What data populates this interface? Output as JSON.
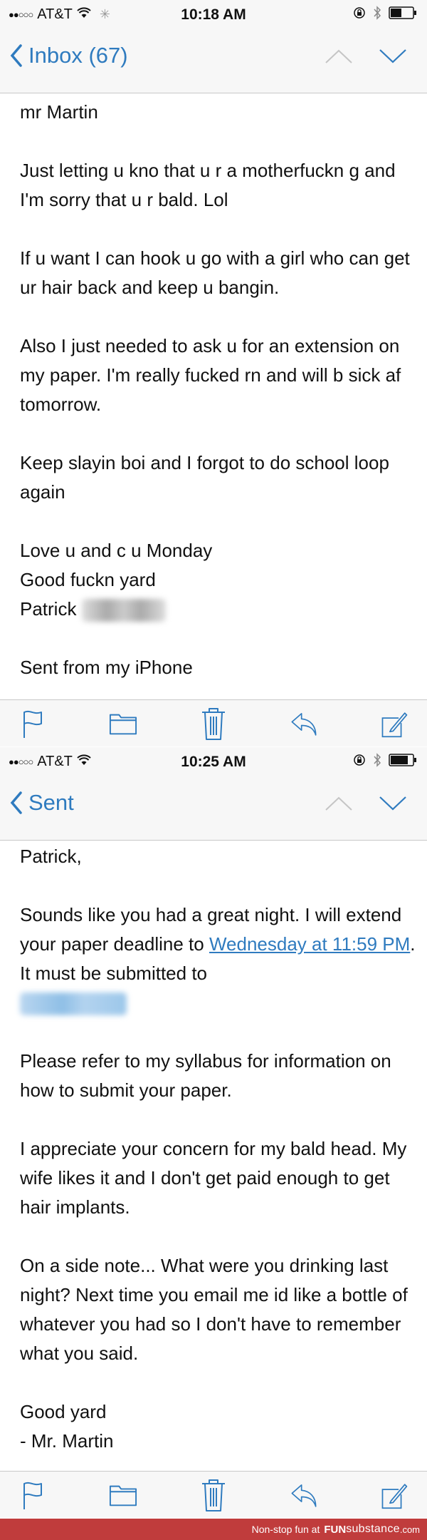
{
  "colors": {
    "accent": "#2f7bbf",
    "chrome_bg": "#f7f7f7",
    "banner_bg": "#c03c3c",
    "text": "#111111"
  },
  "screens": [
    {
      "status": {
        "signal_dots": "●●○○○",
        "carrier": "AT&T",
        "time": "10:18 AM",
        "battery_level": 0.5
      },
      "nav": {
        "back_label": "Inbox (67)"
      },
      "paragraphs": [
        "mr Martin",
        "Just letting u kno that u r a motherfuckn g and I'm sorry that u r bald. Lol",
        "If u want I can hook u go with a girl who can get ur hair back and keep u bangin.",
        "Also I just needed to ask u for an extension on my paper. I'm really fucked rn and will b sick af tomorrow.",
        "Keep slayin boi and I forgot to do school loop again"
      ],
      "closing": {
        "line1": "Love u and c u Monday",
        "line2": "Good fuckn yard",
        "name": "Patrick",
        "surname_redacted": "[redacted]"
      },
      "signature": "Sent from my iPhone"
    },
    {
      "status": {
        "signal_dots": "●●○○○",
        "carrier": "AT&T",
        "time": "10:25 AM",
        "battery_level": 0.8
      },
      "nav": {
        "back_label": "Sent"
      },
      "greeting": "Patrick,",
      "p1_before_link": "Sounds like you had a great night. I will extend your paper deadline to ",
      "p1_link": "Wednesday at 11:59 PM",
      "p1_after_link": ". It must be submitted to",
      "p1_redacted_link": "[redacted]",
      "paragraphs": [
        "Please refer to my syllabus for information on how to submit your paper.",
        "I appreciate your concern for my bald head. My wife likes it and I don't get paid enough to get hair implants.",
        "On a side note... What were you drinking last night? Next time you email me id like a bottle of whatever you had so I don't have to remember what you said."
      ],
      "closing": {
        "line1": "Good yard",
        "line2": "- Mr. Martin"
      }
    }
  ],
  "toolbar_icons": [
    "flag-icon",
    "folder-icon",
    "trash-icon",
    "reply-icon",
    "compose-icon"
  ],
  "banner": {
    "prefix": "Non-stop fun at",
    "brand_bold": "FUN",
    "brand_rest": "substance",
    "tld": ".com"
  }
}
